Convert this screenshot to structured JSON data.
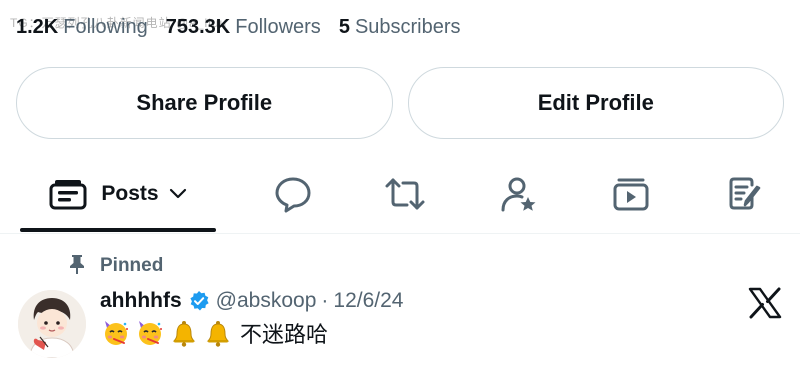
{
  "profile": {
    "stats": [
      {
        "value": "1.2K",
        "label": "Following"
      },
      {
        "value": "753.3K",
        "label": "Followers"
      },
      {
        "value": "5",
        "label": "Subscribers"
      }
    ],
    "watermark": "TG：万瑟列孔八卦新闻电站 @a_liuu"
  },
  "actions": {
    "share_label": "Share Profile",
    "edit_label": "Edit Profile"
  },
  "tabs": {
    "active_label": "Posts",
    "icons": [
      "posts-icon",
      "chevron-down-icon",
      "replies-icon",
      "reposts-icon",
      "highlights-icon",
      "media-icon",
      "articles-icon"
    ]
  },
  "post": {
    "pinned_label": "Pinned",
    "author_name": "ahhhhfs",
    "handle": "@abskoop",
    "separator": "·",
    "date": "12/6/24",
    "emojis": [
      "partying-face",
      "partying-face",
      "bell",
      "bell"
    ],
    "text": "不迷路哈"
  },
  "colors": {
    "text_primary": "#0f1419",
    "text_secondary": "#536471",
    "border": "#cfd9de",
    "verified_blue": "#1d9bf0"
  }
}
